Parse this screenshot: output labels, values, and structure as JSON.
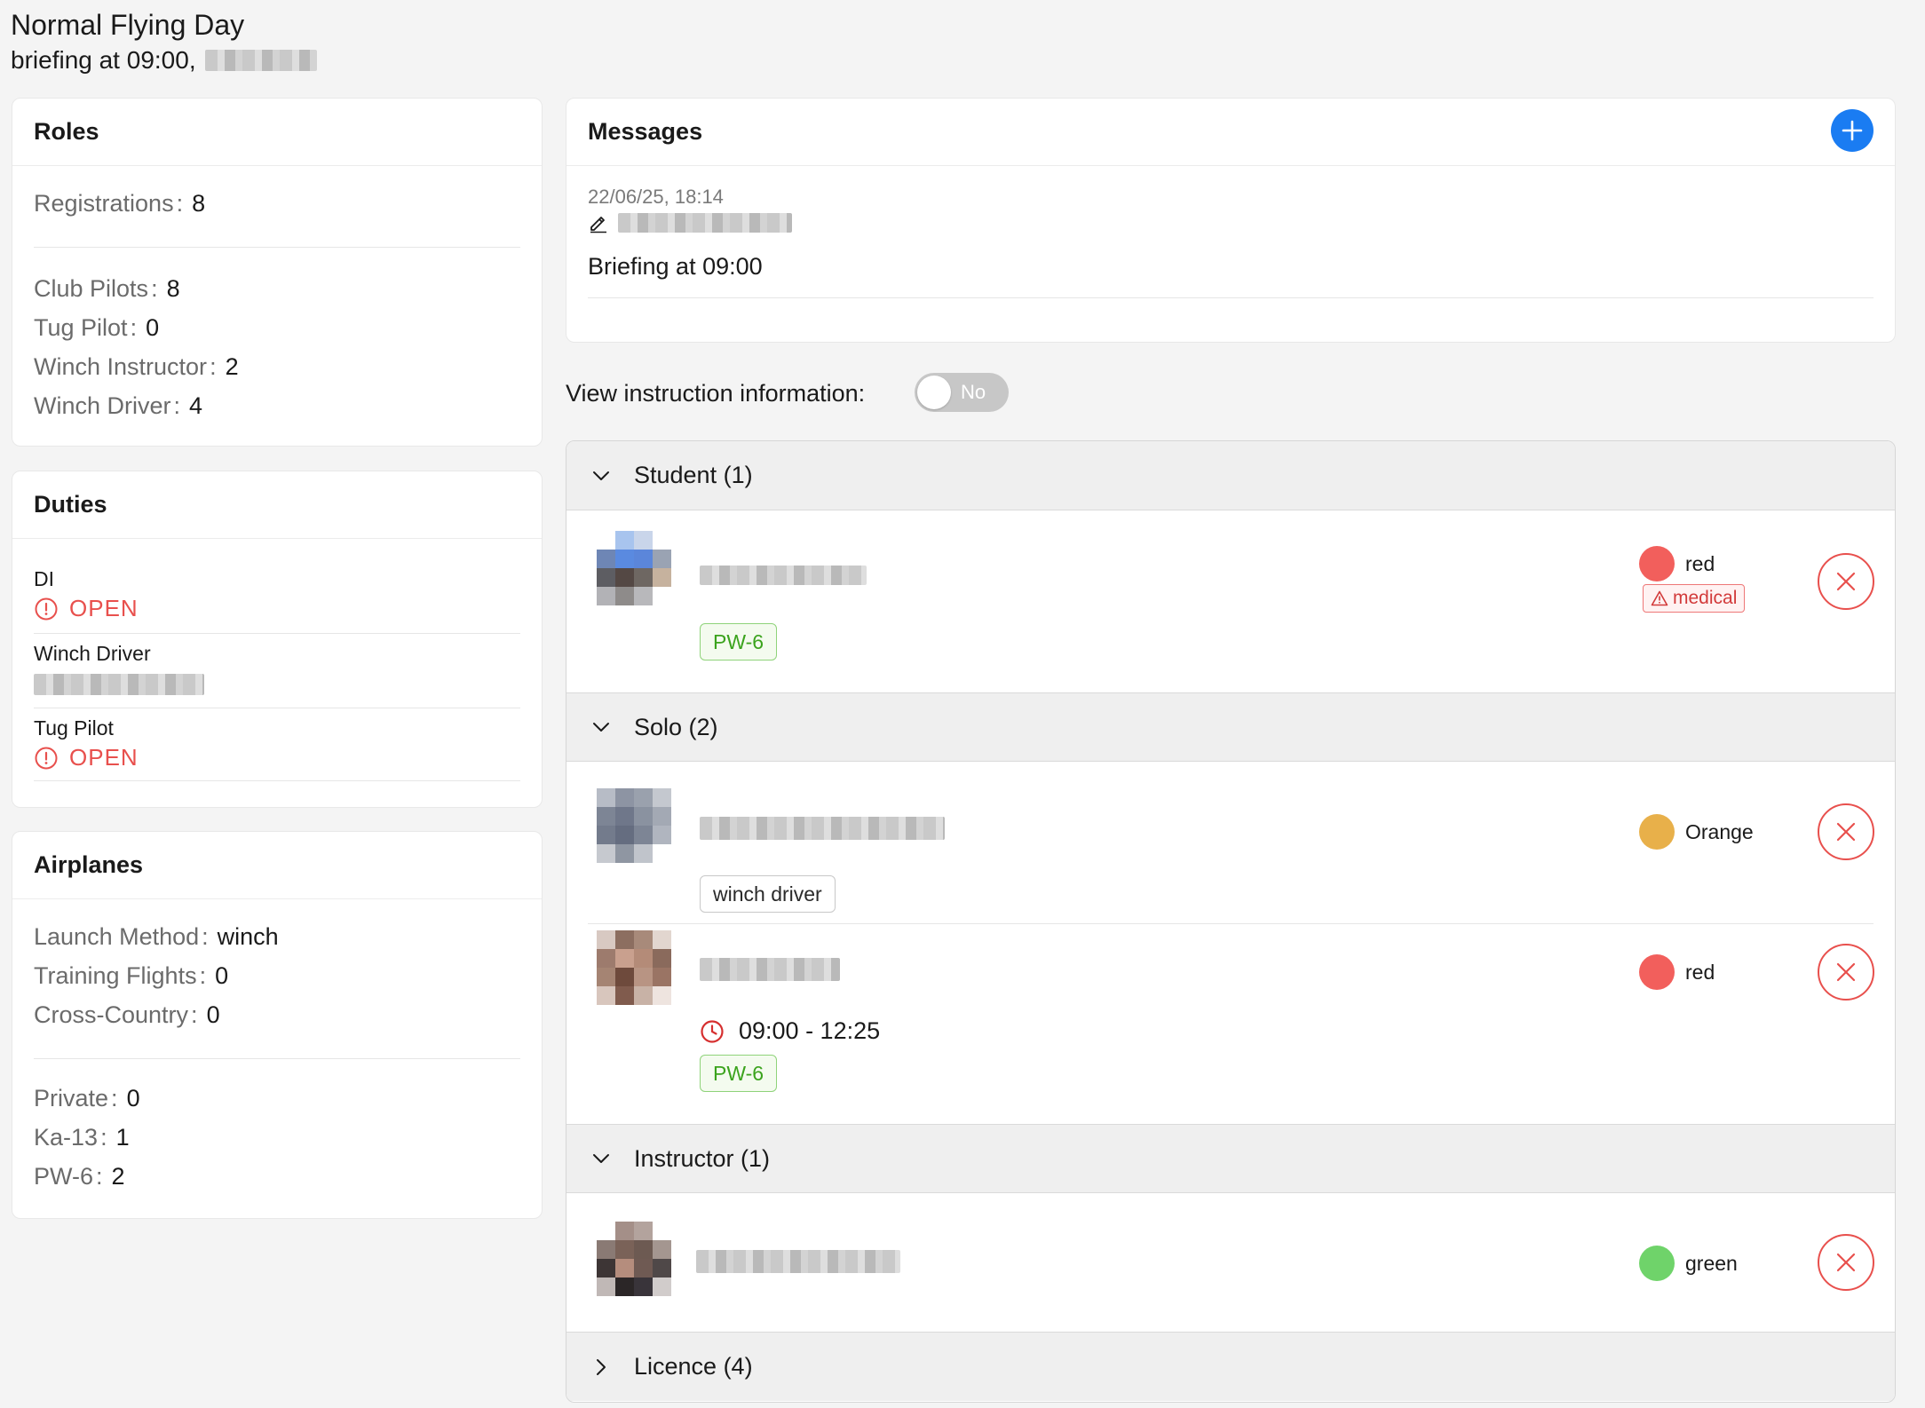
{
  "header": {
    "title": "Normal Flying Day",
    "subtitle": "briefing at 09:00,"
  },
  "roles": {
    "title": "Roles",
    "registrations": {
      "label": "Registrations",
      "value": "8"
    },
    "items": [
      {
        "label": "Club Pilots",
        "value": "8"
      },
      {
        "label": "Tug Pilot",
        "value": "0"
      },
      {
        "label": "Winch Instructor",
        "value": "2"
      },
      {
        "label": "Winch Driver",
        "value": "4"
      }
    ]
  },
  "duties": {
    "title": "Duties",
    "items": [
      {
        "name": "DI",
        "status": "OPEN"
      },
      {
        "name": "Winch Driver",
        "status": ""
      },
      {
        "name": "Tug Pilot",
        "status": "OPEN"
      }
    ]
  },
  "airplanes": {
    "title": "Airplanes",
    "group1": [
      {
        "label": "Launch Method",
        "value": "winch"
      },
      {
        "label": "Training Flights",
        "value": "0"
      },
      {
        "label": "Cross-Country",
        "value": "0"
      }
    ],
    "group2": [
      {
        "label": "Private",
        "value": "0"
      },
      {
        "label": "Ka-13",
        "value": "1"
      },
      {
        "label": "PW-6",
        "value": "2"
      }
    ]
  },
  "messages": {
    "title": "Messages",
    "items": [
      {
        "timestamp": "22/06/25, 18:14",
        "text": "Briefing at 09:00"
      }
    ]
  },
  "instruction_toggle": {
    "label": "View instruction information:",
    "state": "No"
  },
  "groups": {
    "student": {
      "title": "Student (1)",
      "members": [
        {
          "status": "red",
          "status_color": "#f25f5c",
          "warning": "medical",
          "tag": "PW-6"
        }
      ]
    },
    "solo": {
      "title": "Solo (2)",
      "members": [
        {
          "status": "Orange",
          "status_color": "#e8b04a",
          "tag": "winch driver"
        },
        {
          "status": "red",
          "status_color": "#f25f5c",
          "time": "09:00 - 12:25",
          "tag": "PW-6"
        }
      ]
    },
    "instructor": {
      "title": "Instructor (1)",
      "members": [
        {
          "status": "green",
          "status_color": "#6fd36a"
        }
      ]
    },
    "licence": {
      "title": "Licence (4)"
    }
  },
  "icons": {
    "add": "plus-icon",
    "edit": "pencil-icon",
    "open_alert": "exclamation-circle-icon",
    "medical": "warning-triangle-icon",
    "time": "clock-icon",
    "remove": "close-circle-icon",
    "expand": "chevron-down-icon",
    "collapsed": "chevron-right-icon"
  },
  "colors": {
    "accent": "#1a7cf2",
    "danger": "#e8504d",
    "success_tag": "#3ba31d"
  }
}
